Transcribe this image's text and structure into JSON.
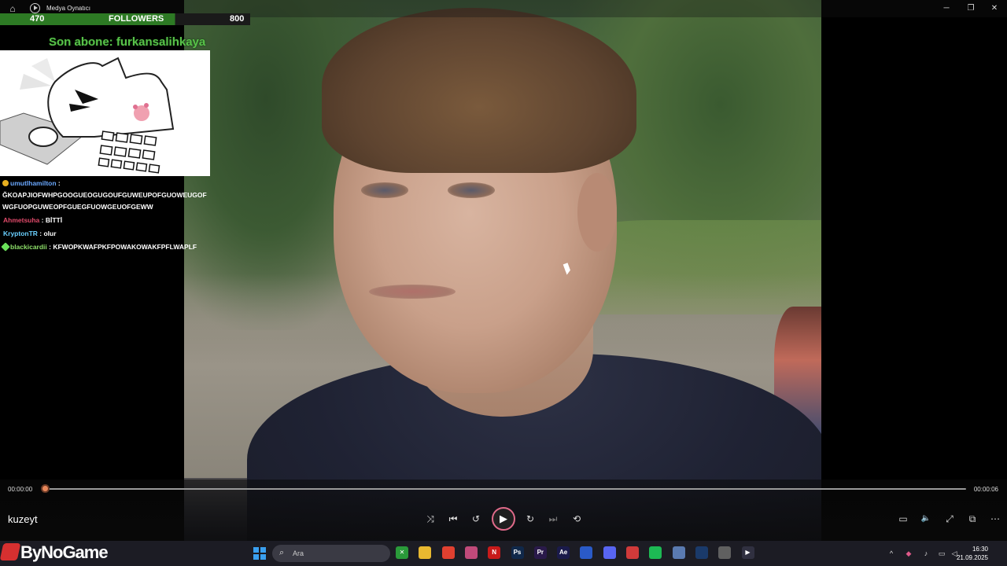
{
  "window": {
    "title": "Medya Oynatıcı",
    "minimize_glyph": "─",
    "maximize_glyph": "❐",
    "close_glyph": "✕"
  },
  "overlay": {
    "followers_current": "470",
    "followers_label": "FOLLOWERS",
    "followers_goal": "800",
    "last_subscriber": "Son abone: furkansalihkaya"
  },
  "chat": {
    "messages": [
      {
        "user": "umutlhamilton",
        "user_color": "#6aa8ff",
        "badge_color": "#e8b020",
        "text": "ĞKOAPJIOFWHPGOOGUEOGUGOUFGUWEUPOFGUOWEUGOF",
        "text2": "WGFUOPGUWEOPFGUEGFUOWGEUOFGEWW"
      },
      {
        "user": "Ahmetsuha",
        "user_color": "#e04a6a",
        "badge_color": "",
        "text": "BİTTİ"
      },
      {
        "user": "KryptonTR",
        "user_color": "#6ad0ff",
        "badge_color": "",
        "text": "olur"
      },
      {
        "user": "blackicardii",
        "user_color": "#8ee06a",
        "badge_color": "#6ae05a",
        "text": "KFWOPKWAFPKFPOWAKOWAKFPFLWAPLF"
      }
    ]
  },
  "player": {
    "time_current": "00:00:00",
    "time_total": "00:00:06",
    "progress": 0.0,
    "media_title": "kuzeyt",
    "icons": {
      "shuffle": "⤨",
      "previous": "⏮",
      "rewind": "↺",
      "play": "▶",
      "forward": "↻",
      "next": "⏭",
      "repeat": "⟲",
      "miniplayer": "▭",
      "volume": "🔈",
      "fullscreen": "⤢",
      "cast": "⧉",
      "more": "⋯"
    }
  },
  "taskbar": {
    "brand": "ByNoGame",
    "search_placeholder": "Ara",
    "clock_time": "16:30",
    "clock_date": "21.09.2025",
    "apps": [
      {
        "name": "xbox",
        "label": "✕",
        "color": "#2a9a3a"
      },
      {
        "name": "files",
        "label": "",
        "color": "#e8b830"
      },
      {
        "name": "chrome",
        "label": "",
        "color": "#e04030"
      },
      {
        "name": "app-pink",
        "label": "",
        "color": "#c04a7a"
      },
      {
        "name": "netflix",
        "label": "N",
        "color": "#c81a1a"
      },
      {
        "name": "photoshop",
        "label": "Ps",
        "color": "#10284a"
      },
      {
        "name": "premiere",
        "label": "Pr",
        "color": "#2a1a4a"
      },
      {
        "name": "after-effects",
        "label": "Ae",
        "color": "#1a1a4a"
      },
      {
        "name": "app-blue",
        "label": "",
        "color": "#2a5ac8"
      },
      {
        "name": "discord",
        "label": "",
        "color": "#5865f2"
      },
      {
        "name": "app-red",
        "label": "",
        "color": "#d03a3a"
      },
      {
        "name": "spotify",
        "label": "",
        "color": "#1db954"
      },
      {
        "name": "app-cube",
        "label": "",
        "color": "#5a7ab0"
      },
      {
        "name": "steam",
        "label": "",
        "color": "#1a3a6a"
      },
      {
        "name": "app-chrome2",
        "label": "",
        "color": "#606060"
      },
      {
        "name": "media-player",
        "label": "▶",
        "color": "#303040"
      }
    ]
  }
}
